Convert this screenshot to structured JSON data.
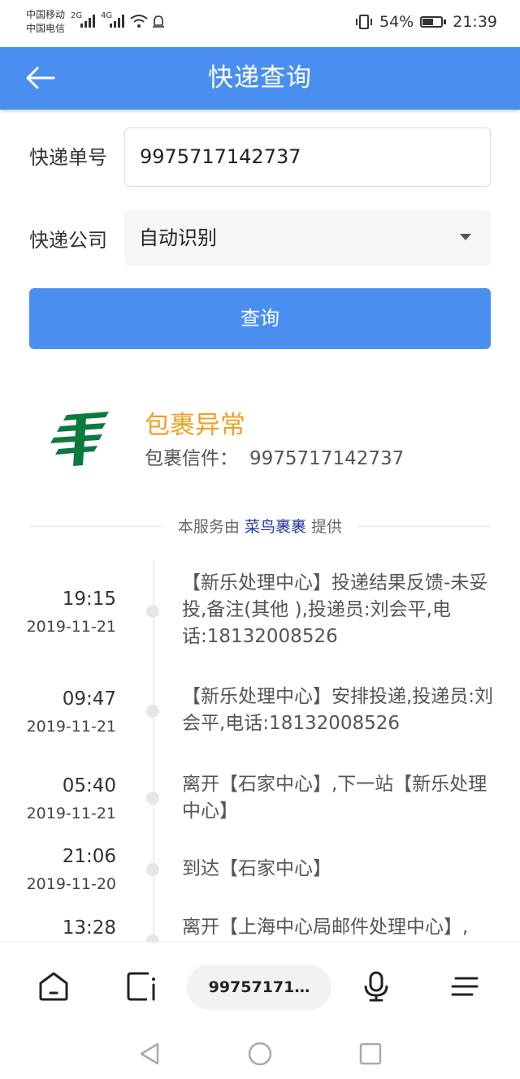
{
  "status_bar": {
    "carrier1": "中国移动",
    "carrier2": "中国电信",
    "net1": "2G",
    "net2": "4G",
    "battery": "54%",
    "time": "21:39"
  },
  "header": {
    "title": "快递查询"
  },
  "form": {
    "tracking_label": "快递单号",
    "tracking_value": "9975717142737",
    "company_label": "快递公司",
    "company_value": "自动识别",
    "query_label": "查询"
  },
  "result": {
    "status": "包裹异常",
    "parcel_label": "包裹信件：",
    "parcel_number": "9975717142737",
    "provider_prefix": "本服务由",
    "provider_name": "菜鸟裹裹",
    "provider_suffix": "提供"
  },
  "timeline": [
    {
      "time": "19:15",
      "date": "2019-11-21",
      "text": "【新乐处理中心】投递结果反馈-未妥投,备注(其他 ),投递员:刘会平,电话:18132008526"
    },
    {
      "time": "09:47",
      "date": "2019-11-21",
      "text": "【新乐处理中心】安排投递,投递员:刘会平,电话:18132008526"
    },
    {
      "time": "05:40",
      "date": "2019-11-21",
      "text": "离开【石家中心】,下一站【新乐处理中心】"
    },
    {
      "time": "21:06",
      "date": "2019-11-20",
      "text": "到达【石家中心】"
    },
    {
      "time": "13:28",
      "date": "",
      "text": "离开【上海中心局邮件处理中心】,"
    }
  ],
  "toolbar": {
    "url_text": "99757171…",
    "icons": [
      "home-icon",
      "tabs-icon",
      "microphone-icon",
      "menu-icon"
    ]
  },
  "colors": {
    "primary": "#4a8ff0",
    "warning": "#f0a023",
    "logo_green": "#0c7a3e",
    "provider_link": "#2436a8"
  }
}
